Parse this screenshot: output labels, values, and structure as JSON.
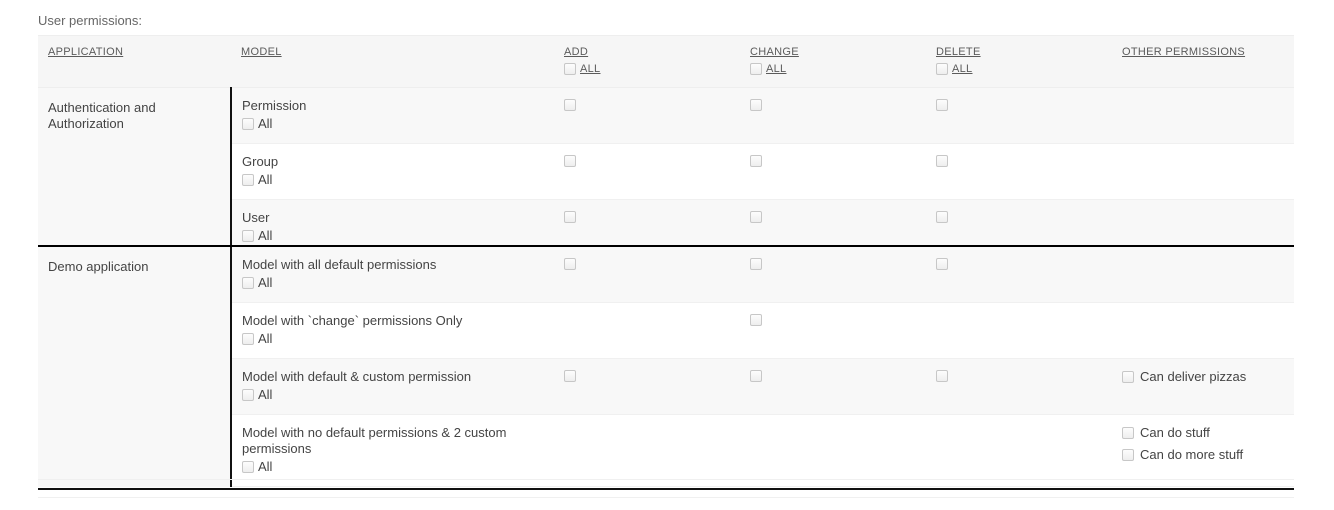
{
  "caption": "User permissions:",
  "columns": {
    "application": "APPLICATION",
    "model": "MODEL",
    "add": "ADD",
    "change": "CHANGE",
    "delete": "DELETE",
    "other": "OTHER PERMISSIONS",
    "all_label": "ALL"
  },
  "row_all_label": "All",
  "sections": [
    {
      "application": "Authentication and Authorization",
      "rows": [
        {
          "model": "Permission",
          "all": "All",
          "add": true,
          "change": true,
          "delete": true,
          "other": []
        },
        {
          "model": "Group",
          "all": "All",
          "add": true,
          "change": true,
          "delete": true,
          "other": []
        },
        {
          "model": "User",
          "all": "All",
          "add": true,
          "change": true,
          "delete": true,
          "other": []
        }
      ]
    },
    {
      "application": "Demo application",
      "rows": [
        {
          "model": "Model with all default permissions",
          "all": "All",
          "add": true,
          "change": true,
          "delete": true,
          "other": []
        },
        {
          "model": "Model with `change` permissions Only",
          "all": "All",
          "add": false,
          "change": true,
          "delete": false,
          "other": []
        },
        {
          "model": "Model with default & custom permission",
          "all": "All",
          "add": true,
          "change": true,
          "delete": true,
          "other": [
            "Can deliver pizzas"
          ]
        },
        {
          "model": "Model with no default permissions & 2 custom permissions",
          "all": "All",
          "add": false,
          "change": false,
          "delete": false,
          "other": [
            "Can do stuff",
            "Can do more stuff"
          ]
        }
      ]
    }
  ],
  "colors": {
    "header_bg": "#f6f6f6",
    "row_odd_bg": "#f8f8f8",
    "row_even_bg": "#ffffff",
    "divider": "#111111",
    "text": "#444444",
    "muted_text": "#666666"
  }
}
